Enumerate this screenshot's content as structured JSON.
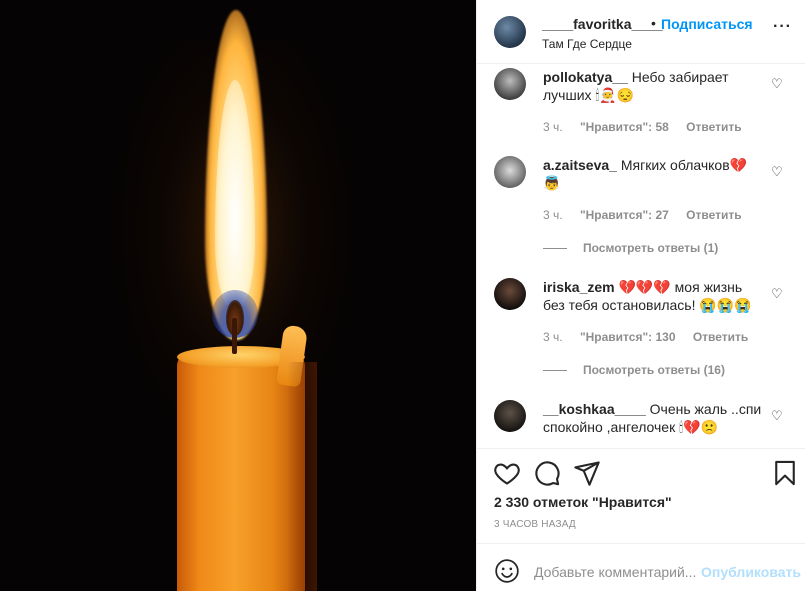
{
  "header": {
    "username": "____favoritka____",
    "dot": "•",
    "follow_label": "Подписаться",
    "location": "Там Где Сердце",
    "more_label": "···"
  },
  "comments": [
    {
      "username": "pollokatya__",
      "text": "Небо забирает лучших 🕯🧑‍🎄😔",
      "time": "3 ч.",
      "likes": "\"Нравится\": 58",
      "reply_label": "Ответить"
    },
    {
      "username": "a.zaitseva_",
      "text": "Мягких облачков💔👼",
      "time": "3 ч.",
      "likes": "\"Нравится\": 27",
      "reply_label": "Ответить",
      "view_replies": "Посмотреть ответы (1)"
    },
    {
      "username": "iriska_zem",
      "text": "💔💔💔 моя жизнь без тебя остановилась! 😭😭😭",
      "time": "3 ч.",
      "likes": "\"Нравится\": 130",
      "reply_label": "Ответить",
      "view_replies": "Посмотреть ответы (16)"
    },
    {
      "username": "__koshkaa____",
      "text": "Очень жаль ..спи спокойно ,ангелочек 🕯💔🙁"
    }
  ],
  "actions": {
    "likes": "2 330 отметок \"Нравится\"",
    "time": "3 ЧАСОВ НАЗАД"
  },
  "add_comment": {
    "placeholder": "Добавьте комментарий...",
    "publish_label": "Опубликовать"
  }
}
